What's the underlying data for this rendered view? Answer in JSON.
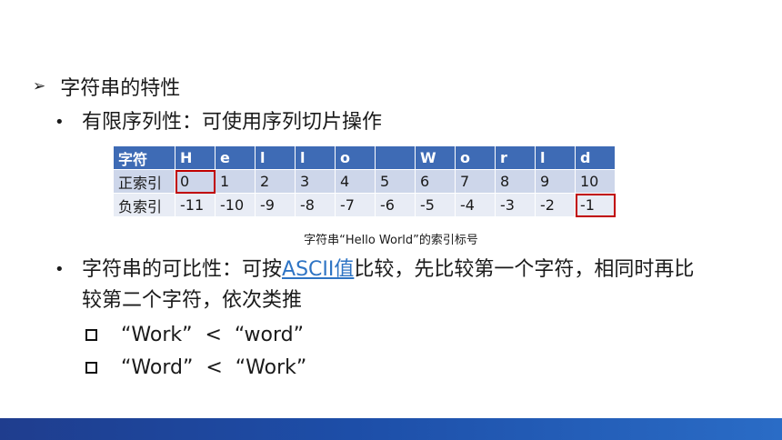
{
  "heading": {
    "marker": "➢",
    "text": "字符串的特性"
  },
  "bullet1": {
    "marker": "•",
    "text": "有限序列性：可使用序列切片操作"
  },
  "table": {
    "header": [
      "字符",
      "H",
      "e",
      "l",
      "l",
      "o",
      "",
      "W",
      "o",
      "r",
      "l",
      "d"
    ],
    "rows": [
      [
        "正索引",
        "0",
        "1",
        "2",
        "3",
        "4",
        "5",
        "6",
        "7",
        "8",
        "9",
        "10"
      ],
      [
        "负索引",
        "-11",
        "-10",
        "-9",
        "-8",
        "-7",
        "-6",
        "-5",
        "-4",
        "-3",
        "-2",
        "-1"
      ]
    ],
    "caption": "字符串“Hello World”的索引标号",
    "highlight_color": "#c00000",
    "header_color": "#3e6bb5"
  },
  "bullet2": {
    "marker": "•",
    "text_before": "字符串的可比性：可按",
    "link_text": "ASCII值",
    "text_after": "比较，先比较第一个字符，相同时再比较第二个字符，依次类推"
  },
  "examples": [
    {
      "text": "“Work”  <  “word”"
    },
    {
      "text": "“Word”  <  “Work”"
    }
  ],
  "footer_color": "#1f3d8e"
}
